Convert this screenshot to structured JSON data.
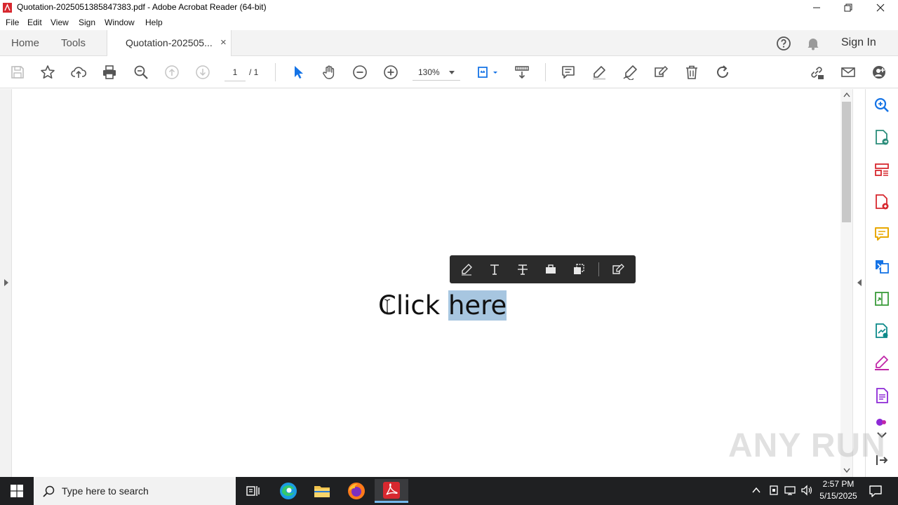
{
  "window": {
    "title": "Quotation-2025051385847383.pdf - Adobe Acrobat Reader (64-bit)",
    "controls": [
      "minimize-icon",
      "restore-icon",
      "close-icon"
    ]
  },
  "menu": [
    "File",
    "Edit",
    "View",
    "Sign",
    "Window",
    "Help"
  ],
  "tabs": {
    "home": "Home",
    "tools": "Tools",
    "document": "Quotation-202505...",
    "close_glyph": "×",
    "sign_in": "Sign In"
  },
  "toolbar": {
    "page_current": "1",
    "page_total": "/ 1",
    "zoom": "130%"
  },
  "document": {
    "text_before": "Click ",
    "text_selected": "here"
  },
  "popup_tools": [
    "highlight-icon",
    "add-text-icon",
    "strikethrough-icon",
    "redact-icon",
    "copy-icon",
    "edit-text-icon"
  ],
  "right_panel_tools": [
    "search-zoom-icon",
    "export-pdf-icon",
    "organize-pages-icon",
    "create-pdf-icon",
    "comment-icon",
    "combine-files-icon",
    "compress-icon",
    "scan-icon",
    "fill-sign-icon",
    "protect-icon",
    "more-tools-icon",
    "expand-icon",
    "collapse-panel-icon"
  ],
  "watermark": "ANY RUN",
  "taskbar": {
    "search_placeholder": "Type here to search",
    "time": "2:57 PM",
    "date": "5/15/2025"
  },
  "colors": {
    "selection": "#a7c6e0",
    "acrobat_red": "#d7282f",
    "toolbar_blue": "#1473e6",
    "popup_bg": "#2b2b2b",
    "taskbar_bg": "#1f2022"
  }
}
